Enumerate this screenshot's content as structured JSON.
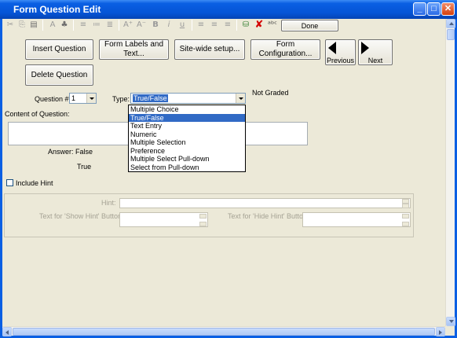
{
  "window": {
    "title": "Form Question Edit",
    "minimize": "_",
    "maximize": "□",
    "close": "✕"
  },
  "toolbar": {
    "done_label": "Done",
    "icons": [
      "cut-icon",
      "copy-icon",
      "paste-icon",
      "font-icon",
      "color-icon",
      "bullet-list-icon",
      "numbered-list-icon",
      "indent-list-icon",
      "font-size-up-icon",
      "font-size-down-icon",
      "bold-icon",
      "italic-icon",
      "underline-icon",
      "align-left-icon",
      "align-center-icon",
      "align-right-icon",
      "save-record-icon",
      "delete-icon",
      "spell-check-icon"
    ],
    "glyphs": {
      "cut": "✂",
      "copy": "⎘",
      "paste": "▤",
      "font": "A",
      "color": "♣",
      "bullets": "≡",
      "numbered": "≔",
      "indent": "≣",
      "size_up": "A⁺",
      "size_down": "A⁻",
      "bold": "B",
      "italic": "i",
      "underline": "u",
      "align_left": "≡",
      "align_center": "≡",
      "align_right": "≡",
      "save_record": "⛁",
      "delete": "✘",
      "spell": "ᵃᵇᶜ"
    }
  },
  "buttons": {
    "insert": "Insert Question",
    "labels": "Form Labels and Text...",
    "sitewide": "Site-wide setup...",
    "formconfig": "Form Configuration...",
    "delete": "Delete Question",
    "previous": "Previous",
    "next": "Next"
  },
  "form": {
    "question_label": "Question #",
    "question_value": "1",
    "type_label": "Type:",
    "type_value": "True/False",
    "graded_status": "Not Graded",
    "content_label": "Content of Question:",
    "answer_label": "Answer: False",
    "answer_value": "True",
    "include_hint_label": "Include Hint",
    "hint_label": "Hint:",
    "show_hint_label": "Text for 'Show Hint' Button:",
    "hide_hint_label": "Text for 'Hide Hint' Button:"
  },
  "type_options": [
    "Multiple Choice",
    "True/False",
    "Text Entry",
    "Numeric",
    "Multiple Selection",
    "Preference",
    "Multiple Select Pull-down",
    "Select from Pull-down"
  ],
  "type_selected_index": 1,
  "colors": {
    "titlebar": "#0554d6",
    "selection": "#316ac5",
    "window_bg": "#ece9d8",
    "delete_icon": "#d40000"
  }
}
